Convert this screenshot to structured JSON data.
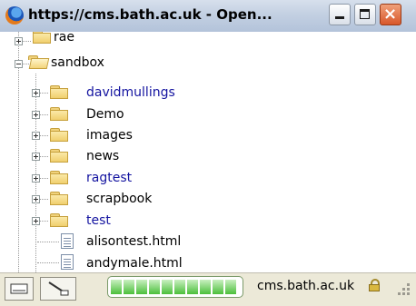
{
  "window": {
    "title": "https://cms.bath.ac.uk - Open...",
    "minimize_label": "",
    "maximize_label": "",
    "close_label": "×"
  },
  "tree": {
    "items": [
      {
        "label": "rae",
        "kind": "folder",
        "state": "collapsed",
        "color": "#000000"
      },
      {
        "label": "sandbox",
        "kind": "folder",
        "state": "expanded",
        "color": "#000000"
      },
      {
        "label": "davidmullings",
        "kind": "folder",
        "state": "collapsed",
        "color": "#1414a0"
      },
      {
        "label": "Demo",
        "kind": "folder",
        "state": "collapsed",
        "color": "#000000"
      },
      {
        "label": "images",
        "kind": "folder",
        "state": "collapsed",
        "color": "#000000"
      },
      {
        "label": "news",
        "kind": "folder",
        "state": "collapsed",
        "color": "#000000"
      },
      {
        "label": "ragtest",
        "kind": "folder",
        "state": "collapsed",
        "color": "#1414a0"
      },
      {
        "label": "scrapbook",
        "kind": "folder",
        "state": "collapsed",
        "color": "#000000"
      },
      {
        "label": "test",
        "kind": "folder",
        "state": "collapsed",
        "color": "#1414a0"
      },
      {
        "label": "alisontest.html",
        "kind": "file",
        "color": "#000000"
      },
      {
        "label": "andymale.html",
        "kind": "file",
        "color": "#000000"
      }
    ]
  },
  "statusbar": {
    "progress_fraction": 1.0,
    "progress_segments": 10,
    "host": "cms.bath.ac.uk",
    "icons": [
      "document-icon",
      "scroll-icon",
      "lock-icon",
      "resize-grip-icon"
    ]
  }
}
